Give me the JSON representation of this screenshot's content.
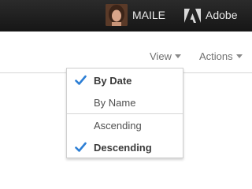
{
  "header": {
    "user_name": "MAILE",
    "brand_name": "Adobe",
    "icons": {
      "avatar": "user-photo",
      "brand_logo": "adobe-logo"
    }
  },
  "toolbar": {
    "view_label": "View",
    "actions_label": "Actions",
    "caret_icon": "caret-down-icon"
  },
  "menu": {
    "items": [
      {
        "label": "By Date",
        "selected": true
      },
      {
        "label": "By Name",
        "selected": false
      },
      {
        "label": "Ascending",
        "selected": false
      },
      {
        "label": "Descending",
        "selected": true
      }
    ],
    "check_icon": "checkmark-icon",
    "check_color": "#2d7fd5"
  },
  "colors": {
    "header_bg": "#1e1e1e",
    "header_text": "#e9e9e9",
    "toolbar_text": "#707070"
  }
}
